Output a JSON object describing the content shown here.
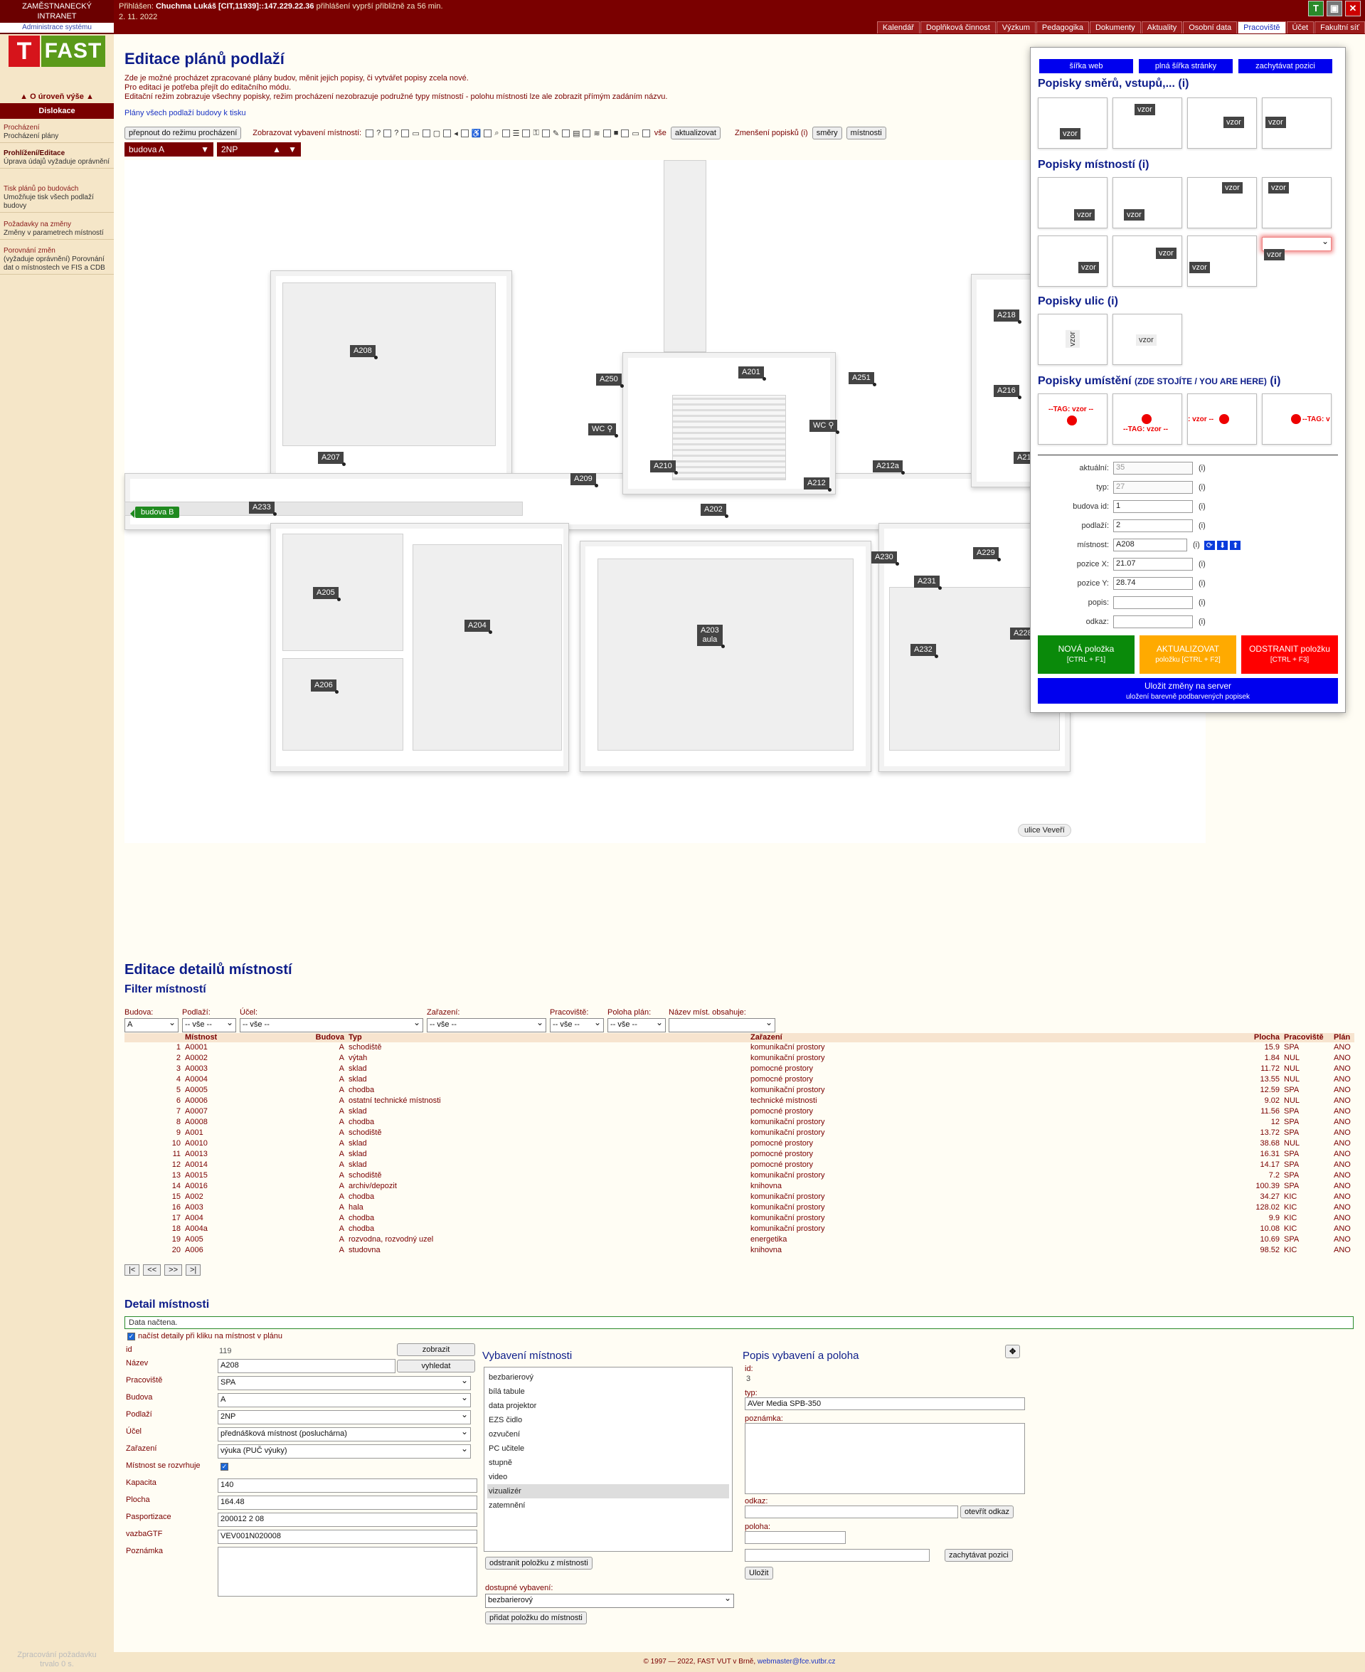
{
  "top": {
    "line1": "ZAMĚSTNANECKÝ",
    "line2": "INTRANET",
    "admin": "Administrace systému",
    "login_label": "Přihlášen:",
    "user": "Chuchma Lukáš [CIT,11939]::147.229.22.36",
    "expiry": "přihlášení vyprší přibližně za 56 min.",
    "date": "2. 11. 2022",
    "icons": [
      "T",
      "▣",
      "✕"
    ],
    "tabs": [
      "Kalendář",
      "Doplňková činnost",
      "Výzkum",
      "Pedagogika",
      "Dokumenty",
      "Aktuality",
      "Osobní data",
      "Pracoviště",
      "Účet",
      "Fakultní síť"
    ],
    "active_tab": "Pracoviště"
  },
  "sidebar": {
    "logo_t": "T",
    "logo_f": "FAST",
    "up": "O úroveň výše",
    "section": "Dislokace",
    "items": [
      {
        "head": "Procházení",
        "desc": "Procházení plány"
      },
      {
        "head": "Prohlížení/Editace",
        "desc": "Úprava údajů vyžaduje oprávnění"
      },
      {
        "head": "Tisk plánů po budovách",
        "desc": "Umožňuje tisk všech podlaží budovy"
      },
      {
        "head": "Požadavky na změny",
        "desc": "Změny v parametrech místností"
      },
      {
        "head": "Porovnání změn",
        "desc": "(vyžaduje oprávnění) Porovnání dat o místnostech ve FIS a CDB"
      }
    ],
    "footer1": "Zpracování požadavku",
    "footer2": "trvalo 0 s."
  },
  "main": {
    "title": "Editace plánů podlaží",
    "intro": [
      "Zde je možné procházet zpracované plány budov, měnit jejich popisy, či vytvářet popisy zcela nové.",
      "Pro editaci je potřeba přejít do editačního módu.",
      "Editační režim zobrazuje všechny popisky, režim procházení nezobrazuje podružné typy místností - polohu místnosti lze ale zobrazit přímým zadáním názvu."
    ],
    "print_link": "Plány všech podlaží budovy k tisku",
    "switch_btn": "přepnout do režimu procházení",
    "show_label": "Zobrazovat vybavení místností:",
    "all_label": "vše",
    "refresh_btn": "aktualizovat",
    "reduce_label": "Zmenšení popisků (i)",
    "dirs_btn": "směry",
    "rooms_btn": "místnosti",
    "building": "budova A",
    "floor": "2NP"
  },
  "plan": {
    "rooms": [
      "A208",
      "A207",
      "A233",
      "A205",
      "A206",
      "A204",
      "A250",
      "A201",
      "A251",
      "WC",
      "WC",
      "A209",
      "A210",
      "A212",
      "A212a",
      "A202",
      "A203",
      "aula",
      "A230",
      "A231",
      "A229",
      "A232",
      "A218",
      "A216",
      "A21",
      "A228"
    ],
    "building_b": "budova B",
    "street": "ulice Veveří"
  },
  "panel": {
    "btns": [
      "šířka web",
      "plná šířka stránky",
      "zachytávat pozici"
    ],
    "h_dirs": "Popisky směrů, vstupů,...",
    "h_rooms": "Popisky místností",
    "h_streets": "Popisky ulic",
    "h_place": "Popisky umístění",
    "h_place_small": "(ZDE STOJÍTE / YOU ARE HERE)",
    "info": "(i)",
    "vzor": "vzor",
    "tag": "--TAG: vzor --",
    "fields": [
      {
        "label": "aktuální:",
        "value": "35"
      },
      {
        "label": "typ:",
        "value": "27"
      },
      {
        "label": "budova id:",
        "value": "1"
      },
      {
        "label": "podlaží:",
        "value": "2"
      },
      {
        "label": "místnost:",
        "value": "A208"
      },
      {
        "label": "pozice X:",
        "value": "21.07"
      },
      {
        "label": "pozice Y:",
        "value": "28.74"
      },
      {
        "label": "popis:",
        "value": ""
      },
      {
        "label": "odkaz:",
        "value": ""
      }
    ],
    "new_btn": "NOVÁ položka",
    "new_key": "[CTRL + F1]",
    "upd_btn": "AKTUALIZOVAT",
    "upd_key": "položku [CTRL + F2]",
    "del_btn": "ODSTRANIT položku",
    "del_key": "[CTRL + F3]",
    "save1": "Uložit změny na server",
    "save2": "uložení barevně podbarvených popisek",
    "colors": {
      "new": "#0a8a0a",
      "upd": "#ffaa00",
      "del": "#ff0000",
      "save": "#0000ee"
    }
  },
  "details": {
    "title": "Editace detailů místností",
    "filter_title": "Filter místností",
    "filters": [
      {
        "label": "Budova:",
        "value": "A"
      },
      {
        "label": "Podlaží:",
        "value": "-- vše --"
      },
      {
        "label": "Účel:",
        "value": "-- vše --"
      },
      {
        "label": "Zařazení:",
        "value": "-- vše --"
      },
      {
        "label": "Pracoviště:",
        "value": "-- vše --"
      },
      {
        "label": "Poloha plán:",
        "value": "-- vše --"
      },
      {
        "label": "Název míst. obsahuje:",
        "value": ""
      }
    ],
    "cols": [
      "Místnost",
      "Budova",
      "Typ",
      "Zařazení",
      "Plocha",
      "Pracoviště",
      "Plán"
    ],
    "rows": [
      [
        "1",
        "A0001",
        "A",
        "schodiště",
        "komunikační prostory",
        "15.9",
        "SPA",
        "ANO"
      ],
      [
        "2",
        "A0002",
        "A",
        "výtah",
        "komunikační prostory",
        "1.84",
        "NUL",
        "ANO"
      ],
      [
        "3",
        "A0003",
        "A",
        "sklad",
        "pomocné prostory",
        "11.72",
        "NUL",
        "ANO"
      ],
      [
        "4",
        "A0004",
        "A",
        "sklad",
        "pomocné prostory",
        "13.55",
        "NUL",
        "ANO"
      ],
      [
        "5",
        "A0005",
        "A",
        "chodba",
        "komunikační prostory",
        "12.59",
        "SPA",
        "ANO"
      ],
      [
        "6",
        "A0006",
        "A",
        "ostatní technické místnosti",
        "technické místnosti",
        "9.02",
        "NUL",
        "ANO"
      ],
      [
        "7",
        "A0007",
        "A",
        "sklad",
        "pomocné prostory",
        "11.56",
        "SPA",
        "ANO"
      ],
      [
        "8",
        "A0008",
        "A",
        "chodba",
        "komunikační prostory",
        "12",
        "SPA",
        "ANO"
      ],
      [
        "9",
        "A001",
        "A",
        "schodiště",
        "komunikační prostory",
        "13.72",
        "SPA",
        "ANO"
      ],
      [
        "10",
        "A0010",
        "A",
        "sklad",
        "pomocné prostory",
        "38.68",
        "NUL",
        "ANO"
      ],
      [
        "11",
        "A0013",
        "A",
        "sklad",
        "pomocné prostory",
        "16.31",
        "SPA",
        "ANO"
      ],
      [
        "12",
        "A0014",
        "A",
        "sklad",
        "pomocné prostory",
        "14.17",
        "SPA",
        "ANO"
      ],
      [
        "13",
        "A0015",
        "A",
        "schodiště",
        "komunikační prostory",
        "7.2",
        "SPA",
        "ANO"
      ],
      [
        "14",
        "A0016",
        "A",
        "archiv/depozit",
        "knihovna",
        "100.39",
        "SPA",
        "ANO"
      ],
      [
        "15",
        "A002",
        "A",
        "chodba",
        "komunikační prostory",
        "34.27",
        "KIC",
        "ANO"
      ],
      [
        "16",
        "A003",
        "A",
        "hala",
        "komunikační prostory",
        "128.02",
        "KIC",
        "ANO"
      ],
      [
        "17",
        "A004",
        "A",
        "chodba",
        "komunikační prostory",
        "9.9",
        "KIC",
        "ANO"
      ],
      [
        "18",
        "A004a",
        "A",
        "chodba",
        "komunikační prostory",
        "10.08",
        "KIC",
        "ANO"
      ],
      [
        "19",
        "A005",
        "A",
        "rozvodna, rozvodný uzel",
        "energetika",
        "10.69",
        "SPA",
        "ANO"
      ],
      [
        "20",
        "A006",
        "A",
        "studovna",
        "knihovna",
        "98.52",
        "KIC",
        "ANO"
      ]
    ],
    "pager": [
      "|<",
      "<<",
      ">>",
      ">|"
    ],
    "detail_title": "Detail místnosti",
    "msg": "Data načtena.",
    "load_cb": "načíst detaily při kliku na místnost v plánu",
    "btn_show": "zobrazit",
    "btn_find": "vyhledat",
    "form": [
      {
        "label": "id",
        "value": "119"
      },
      {
        "label": "Název",
        "value": "A208"
      },
      {
        "label": "Pracoviště",
        "value": "SPA"
      },
      {
        "label": "Budova",
        "value": "A"
      },
      {
        "label": "Podlaží",
        "value": "2NP"
      },
      {
        "label": "Účel",
        "value": "přednášková místnost (posluchárna)"
      },
      {
        "label": "Zařazení",
        "value": "výuka (PUČ výuky)"
      },
      {
        "label": "Místnost se rozvrhuje",
        "value": ""
      },
      {
        "label": "Kapacita",
        "value": "140"
      },
      {
        "label": "Plocha",
        "value": "164.48"
      },
      {
        "label": "Pasportizace",
        "value": "200012 2 08"
      },
      {
        "label": "vazbaGTF",
        "value": "VEV001N020008"
      },
      {
        "label": "Poznámka",
        "value": ""
      }
    ],
    "equip_title": "Vybavení místnosti",
    "equip": [
      "bezbarierový",
      "bílá tabule",
      "data projektor",
      "EZS čidlo",
      "ozvučení",
      "PC učitele",
      "stupně",
      "video",
      "vizualizér",
      "zatemnění"
    ],
    "equip_selected": "vizualizér",
    "remove_btn": "odstranit položku z místnosti",
    "avail_label": "dostupné vybavení:",
    "avail_value": "bezbarierový",
    "add_btn": "přidat položku do místnosti",
    "desc_title": "Popis vybavení a poloha",
    "d_id_label": "id:",
    "d_id": "3",
    "d_type_label": "typ:",
    "d_type": "AVer Media SPB-350",
    "d_note_label": "poznámka:",
    "d_link_label": "odkaz:",
    "d_open": "otevřít odkaz",
    "d_pos_label": "poloha:",
    "d_capture": "zachytávat pozici",
    "d_save": "Uložit"
  },
  "footer": {
    "copy": "© 1997 — 2022, FAST VUT v Brně,",
    "mail": "webmaster@fce.vutbr.cz"
  }
}
